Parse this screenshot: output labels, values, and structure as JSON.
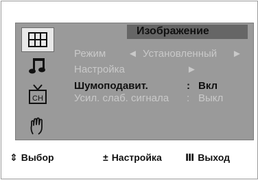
{
  "menu": {
    "title": "Изображение",
    "rows": [
      {
        "label": "Режим",
        "left_arrow": "◄",
        "value": "Установленный",
        "right_arrow": "►"
      },
      {
        "label": "Настройка",
        "right_arrow": "►"
      },
      {
        "label": "Шумоподавит.",
        "sep": ":",
        "value": "Вкл"
      },
      {
        "label": "Усил. слаб. сигнала",
        "sep": ":",
        "value": "Выкл"
      }
    ]
  },
  "side_icons": [
    {
      "name": "picture-icon",
      "selected": true
    },
    {
      "name": "sound-icon"
    },
    {
      "name": "channel-icon",
      "text": "CH"
    },
    {
      "name": "setup-hand-icon"
    }
  ],
  "footer": {
    "select_symbol": "⇕",
    "select_label": "Выбор",
    "adjust_symbol": "±",
    "adjust_label": "Настройка",
    "exit_symbol": "Ⅲ",
    "exit_label": "Выход"
  },
  "colors": {
    "panel": "#9a9a9a",
    "title_bar": "#666666",
    "inactive_text": "#c9c9c9",
    "active_text": "#111111"
  }
}
